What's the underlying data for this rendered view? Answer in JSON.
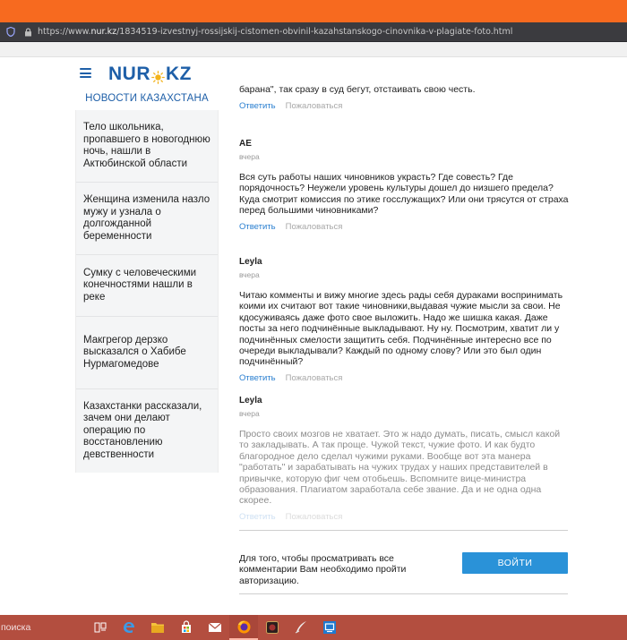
{
  "browser": {
    "url_prefix": "https://www.",
    "url_domain": "nur.kz",
    "url_path": "/1834519-izvestnyj-rossijskij-cistomen-obvinil-kazahstanskogo-cinovnika-v-plagiate-foto.html"
  },
  "logo": {
    "left": "NUR",
    "right": "KZ"
  },
  "sidebar": {
    "title": "НОВОСТИ КАЗАХСТАНА",
    "items": [
      {
        "title": "Тело школьника, пропавшего в новогоднюю ночь, нашли в Актюбинской области"
      },
      {
        "title": "Женщина изменила назло мужу и узнала о долгожданной беременности"
      },
      {
        "title": "Сумку с человеческими конечностями нашли в реке"
      },
      {
        "title": "Макгрегор дерзко высказался о Хабибе Нурмагомедове"
      },
      {
        "title": "Казахстанки рассказали, зачем они делают операцию по восстановлению девственности"
      }
    ]
  },
  "comments": {
    "top_fragment": "барана\", так сразу в суд бегут, отстаивать свою честь.",
    "reply_label": "Ответить",
    "complain_label": "Пожаловаться",
    "items": [
      {
        "author": "AE",
        "date": "вчера",
        "text": "Вся суть работы наших чиновников украсть? Где совесть? Где порядочность? Неужели уровень культуры дошел до низшего предела? Куда смотрит комиссия по этике госслужащих? Или они трясутся от страха перед большими чиновниками?"
      },
      {
        "author": "Leyla",
        "date": "вчера",
        "text": "Читаю комменты и вижу многие здесь рады себя дураками воспринимать коими их считают вот такие чиновники,выдавая чужие мысли за свои. Не кдосуживаясь даже фото свое выложить. Надо же шишка какая. Даже посты за него подчинённые выкладывают. Ну ну. Посмотрим, хватит ли у подчинённых смелости защитить себя. Подчинённые интересно все по очереди выкладывали? Каждый по одному слову? Или это был один подчинённый?"
      },
      {
        "author": "Leyla",
        "date": "вчера",
        "text": "Просто своих мозгов не хватает. Это ж надо думать, писать, смысл какой то закладывать. А так проще. Чужой текст, чужие фото. И как будто благородное дело сделал чужими руками. Вообще вот эта манера \"работать\" и зарабатывать на чужих трудах у наших представителей в привычке, которую фиг чем отобьешь. Вспомните вице-министра образования. Плагиатом заработала себе звание. Да и не одна одна скорее."
      }
    ]
  },
  "auth": {
    "text": "Для того, чтобы просматривать все комментарии Вам необходимо пройти авторизацию.",
    "button": "ВОЙТИ"
  },
  "taskbar": {
    "search_label": "поиска",
    "apps": [
      "task-view",
      "edge",
      "file-explorer",
      "store",
      "mail",
      "firefox",
      "app-game",
      "app-quill",
      "app-remote"
    ]
  },
  "colors": {
    "accent": "#1e5fa8",
    "link": "#2a7fd0",
    "button": "#2a92d8",
    "browser_top": "#f76a1f",
    "taskbar": "#b34e3f"
  }
}
